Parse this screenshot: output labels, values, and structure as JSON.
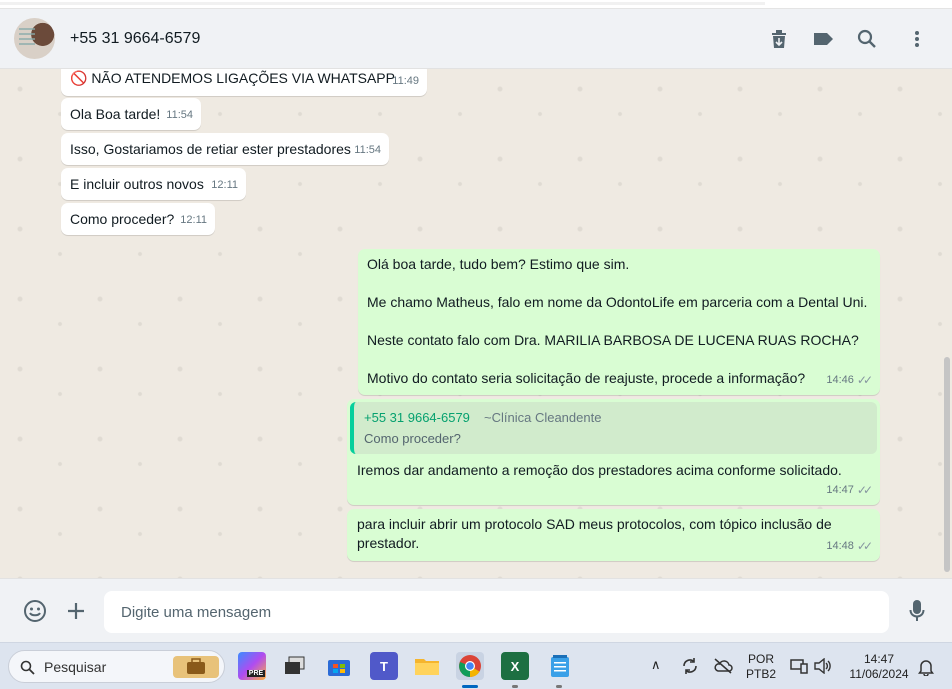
{
  "header": {
    "contact_name": "+55 31 9664-6579"
  },
  "messages_in": [
    {
      "text": "🚫 NÃO ATENDEMOS LIGAÇÕES VIA WHATSAPP",
      "time": "11:49"
    },
    {
      "text": "Ola Boa tarde!",
      "time": "11:54"
    },
    {
      "text": "Isso, Gostariamos de retiar ester prestadores",
      "time": "11:54"
    },
    {
      "text": "E incluir outros novos",
      "time": "12:11"
    },
    {
      "text": "Como proceder?",
      "time": "12:11"
    }
  ],
  "message_out_1": {
    "lines": [
      "Olá boa tarde, tudo bem? Estimo que sim.",
      "Me chamo Matheus, falo em nome da OdontoLife em parceria com a Dental Uni.",
      "Neste contato falo com Dra. MARILIA BARBOSA DE LUCENA RUAS ROCHA?",
      "Motivo do contato seria solicitação de reajuste, procede a informação?"
    ],
    "time": "14:46"
  },
  "message_out_2": {
    "quote_name": "+55 31 9664-6579",
    "quote_sub": "~Clínica Cleandente",
    "quote_text": "Como proceder?",
    "text": "Iremos dar andamento a remoção dos prestadores acima conforme solicitado.",
    "time": "14:47"
  },
  "message_out_3": {
    "line1": "para incluir abrir um protocolo SAD meus protocolos, com tópico inclusão de",
    "line2": "prestador.",
    "time": "14:48"
  },
  "composer": {
    "placeholder": "Digite uma mensagem"
  },
  "taskbar": {
    "search_label": "Pesquisar",
    "lang_top": "POR",
    "lang_bottom": "PTB2",
    "clock_time": "14:47",
    "clock_date": "11/06/2024"
  }
}
